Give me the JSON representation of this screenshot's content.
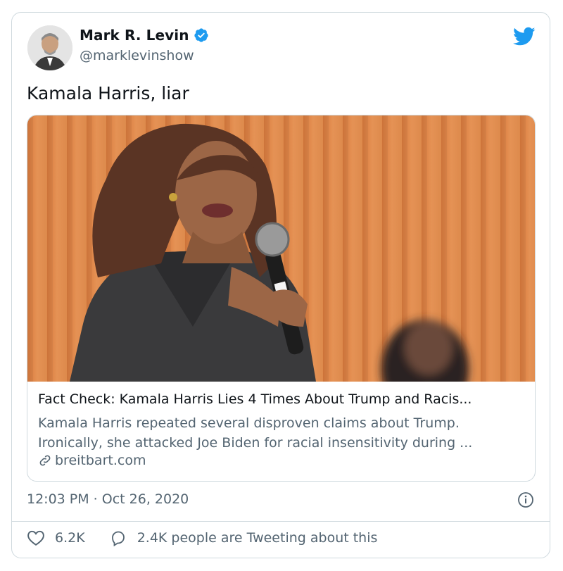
{
  "author": {
    "display_name": "Mark R. Levin",
    "handle": "@marklevinshow",
    "verified": true,
    "avatar_icon": "profile-photo"
  },
  "tweet": {
    "text": "Kamala Harris, liar",
    "timestamp": "12:03 PM · Oct 26, 2020"
  },
  "link_card": {
    "title": "Fact Check: Kamala Harris Lies 4 Times About Trump and Racis...",
    "description_line1": "Kamala Harris repeated several disproven claims about Trump.",
    "description_line2": "Ironically, she attacked Joe Biden for racial insensitivity during ...",
    "domain": "breitbart.com",
    "link_icon": "link-icon",
    "image_icon": "photo-of-speaker-with-microphone"
  },
  "engagement": {
    "likes": "6.2K",
    "tweeting_text": "2.4K people are Tweeting about this"
  },
  "colors": {
    "twitter_blue": "#1d9bf0",
    "secondary_text": "#536471",
    "border": "#cfd9de",
    "image_background": "#e08a4a"
  }
}
